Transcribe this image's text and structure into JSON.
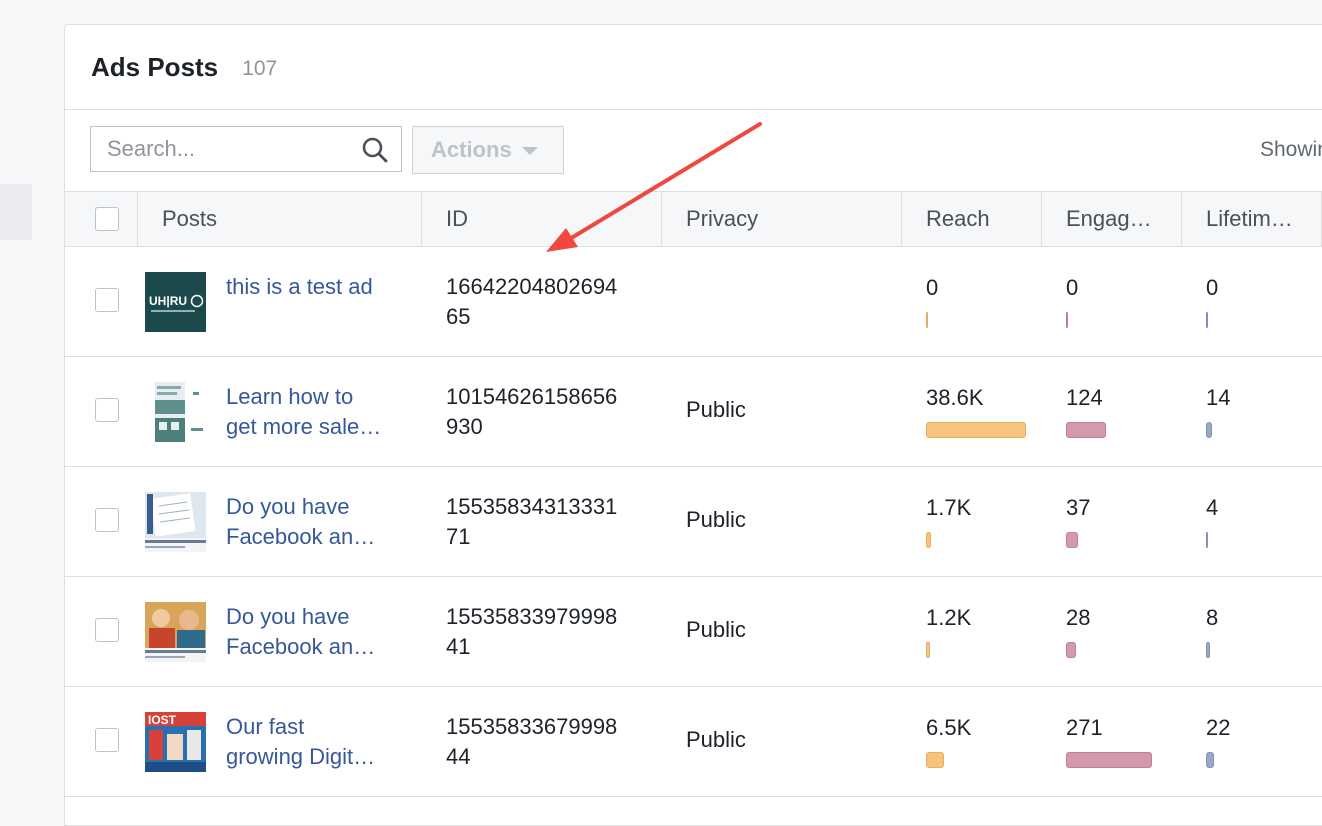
{
  "header": {
    "title": "Ads Posts",
    "count": "107"
  },
  "toolbar": {
    "search_placeholder": "Search...",
    "actions_label": "Actions",
    "showing_text": "Showin"
  },
  "columns": {
    "posts": "Posts",
    "id": "ID",
    "privacy": "Privacy",
    "reach": "Reach",
    "engagement": "Engag…",
    "lifetime": "Lifetim…"
  },
  "rows": [
    {
      "title_line1": "this is a test ad",
      "title_line2": "",
      "id_line1": "16642204802694",
      "id_line2": "65",
      "privacy": "",
      "reach": "0",
      "engagement": "0",
      "lifetime": "0",
      "thumbnail": "uhuru-logo"
    },
    {
      "title_line1": "Learn how to",
      "title_line2": "get more sale…",
      "id_line1": "10154626158656",
      "id_line2": "930",
      "privacy": "Public",
      "reach": "38.6K",
      "engagement": "124",
      "lifetime": "14",
      "thumbnail": "infographic"
    },
    {
      "title_line1": "Do you have",
      "title_line2": "Facebook an…",
      "id_line1": "15535834313331",
      "id_line2": "71",
      "privacy": "Public",
      "reach": "1.7K",
      "engagement": "37",
      "lifetime": "4",
      "thumbnail": "notebook-photo"
    },
    {
      "title_line1": "Do you have",
      "title_line2": "Facebook an…",
      "id_line1": "15535833979998",
      "id_line2": "41",
      "privacy": "Public",
      "reach": "1.2K",
      "engagement": "28",
      "lifetime": "8",
      "thumbnail": "people-photo"
    },
    {
      "title_line1": "Our fast",
      "title_line2": "growing Digit…",
      "id_line1": "15535833679998",
      "id_line2": "44",
      "privacy": "Public",
      "reach": "6.5K",
      "engagement": "271",
      "lifetime": "22",
      "thumbnail": "poster-photo"
    }
  ],
  "colors": {
    "link": "#365899",
    "reach_bar": "#f7c47e",
    "engagement_bar": "#d39aae",
    "lifetime_bar": "#9aa8c8",
    "annotation_arrow": "#f0483e"
  },
  "annotation": {
    "type": "arrow",
    "points_to": "ID column header"
  }
}
